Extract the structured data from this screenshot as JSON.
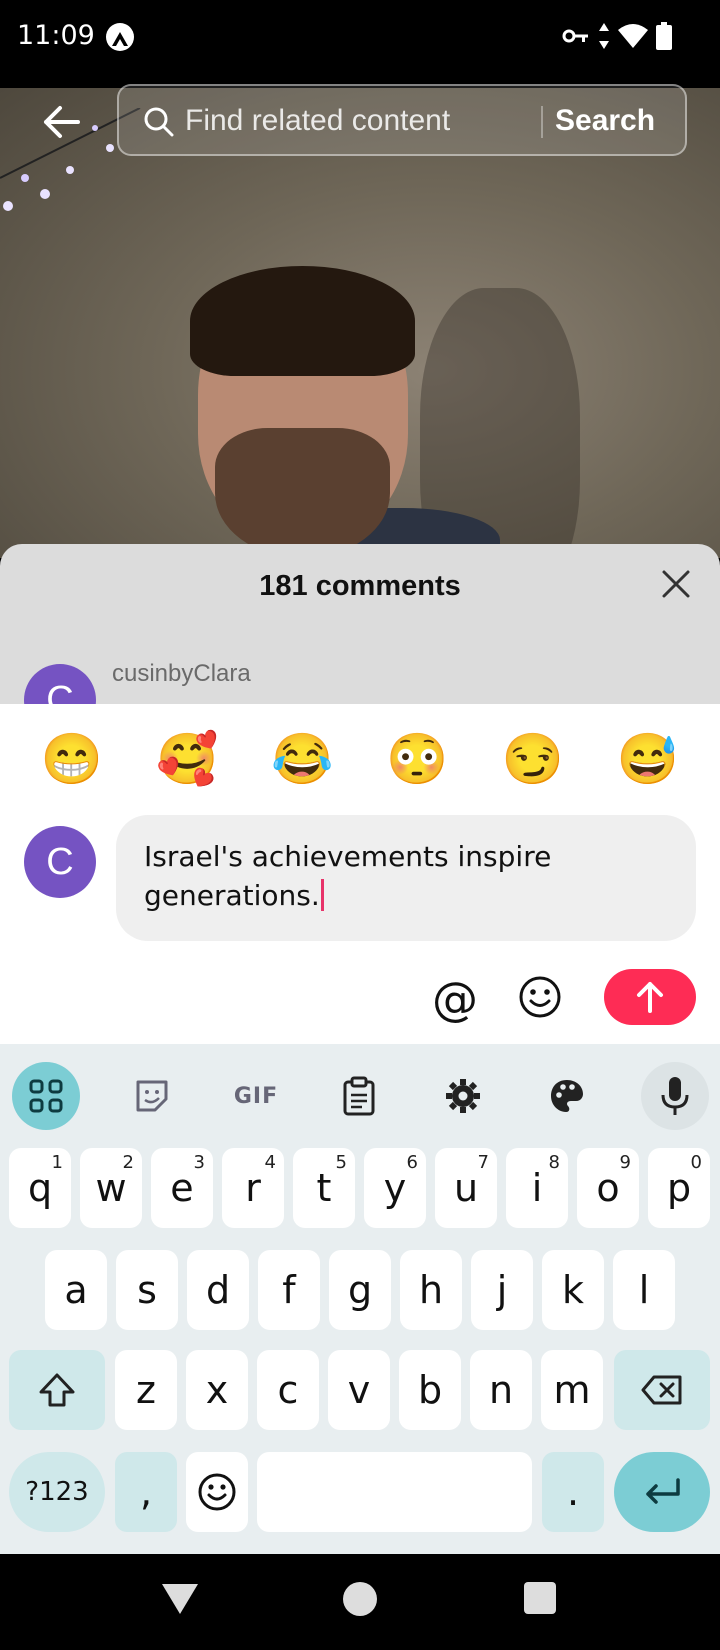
{
  "status_bar": {
    "time": "11:09"
  },
  "search": {
    "placeholder": "Find related content",
    "button_label": "Search"
  },
  "comments_sheet": {
    "title": "181 comments",
    "first_comment": {
      "avatar_letter": "C",
      "username": "cusinbyClara"
    }
  },
  "composer": {
    "quick_emojis": [
      "😁",
      "🥰",
      "😂",
      "😳",
      "😏",
      "😅"
    ],
    "avatar_letter": "C",
    "text": "Israel's achievements inspire generations.",
    "mention_label": "@",
    "send_color": "#fe2c55"
  },
  "keyboard": {
    "toolbar": {
      "gif_label": "GIF"
    },
    "row1": [
      {
        "k": "q",
        "n": "1"
      },
      {
        "k": "w",
        "n": "2"
      },
      {
        "k": "e",
        "n": "3"
      },
      {
        "k": "r",
        "n": "4"
      },
      {
        "k": "t",
        "n": "5"
      },
      {
        "k": "y",
        "n": "6"
      },
      {
        "k": "u",
        "n": "7"
      },
      {
        "k": "i",
        "n": "8"
      },
      {
        "k": "o",
        "n": "9"
      },
      {
        "k": "p",
        "n": "0"
      }
    ],
    "row2": [
      "a",
      "s",
      "d",
      "f",
      "g",
      "h",
      "j",
      "k",
      "l"
    ],
    "row3": [
      "z",
      "x",
      "c",
      "v",
      "b",
      "n",
      "m"
    ],
    "sym_label": "?123",
    "comma_label": ",",
    "period_label": ".",
    "accent_color": "#7ccdd4"
  }
}
